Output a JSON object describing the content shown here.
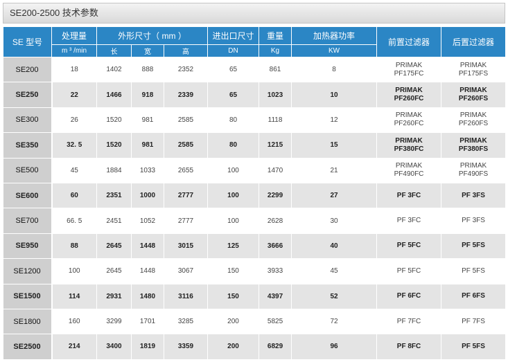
{
  "title": "SE200-2500 技术参数",
  "header": {
    "model": "SE 型号",
    "flow": "处理量",
    "flow_unit": "m ³ /min",
    "dimensions": "外形尺寸（ mm ）",
    "length": "长",
    "width": "宽",
    "height": "高",
    "port": "进出口尺寸",
    "port_unit": "DN",
    "weight": "重量",
    "weight_unit": "Kg",
    "heater": "加热器功率",
    "heater_unit": "KW",
    "pre_filter": "前置过滤器",
    "post_filter": "后置过滤器"
  },
  "rows": [
    {
      "model": "SE200",
      "flow": "18",
      "l": "1402",
      "w": "888",
      "h": "2352",
      "dn": "65",
      "kg": "861",
      "kw": "8",
      "pre1": "PRIMAK",
      "pre2": "PF175FC",
      "post1": "PRIMAK",
      "post2": "PF175FS"
    },
    {
      "model": "SE250",
      "flow": "22",
      "l": "1466",
      "w": "918",
      "h": "2339",
      "dn": "65",
      "kg": "1023",
      "kw": "10",
      "pre1": "PRIMAK",
      "pre2": "PF260FC",
      "post1": "PRIMAK",
      "post2": "PF260FS"
    },
    {
      "model": "SE300",
      "flow": "26",
      "l": "1520",
      "w": "981",
      "h": "2585",
      "dn": "80",
      "kg": "1118",
      "kw": "12",
      "pre1": "PRIMAK",
      "pre2": "PF260FC",
      "post1": "PRIMAK",
      "post2": "PF260FS"
    },
    {
      "model": "SE350",
      "flow": "32. 5",
      "l": "1520",
      "w": "981",
      "h": "2585",
      "dn": "80",
      "kg": "1215",
      "kw": "15",
      "pre1": "PRIMAK",
      "pre2": "PF380FC",
      "post1": "PRIMAK",
      "post2": "PF380FS"
    },
    {
      "model": "SE500",
      "flow": "45",
      "l": "1884",
      "w": "1033",
      "h": "2655",
      "dn": "100",
      "kg": "1470",
      "kw": "21",
      "pre1": "PRIMAK",
      "pre2": "PF490FC",
      "post1": "PRIMAK",
      "post2": "PF490FS"
    },
    {
      "model": "SE600",
      "flow": "60",
      "l": "2351",
      "w": "1000",
      "h": "2777",
      "dn": "100",
      "kg": "2299",
      "kw": "27",
      "pre1": "PF 3FC",
      "pre2": "",
      "post1": "PF 3FS",
      "post2": ""
    },
    {
      "model": "SE700",
      "flow": "66. 5",
      "l": "2451",
      "w": "1052",
      "h": "2777",
      "dn": "100",
      "kg": "2628",
      "kw": "30",
      "pre1": "PF 3FC",
      "pre2": "",
      "post1": "PF 3FS",
      "post2": ""
    },
    {
      "model": "SE950",
      "flow": "88",
      "l": "2645",
      "w": "1448",
      "h": "3015",
      "dn": "125",
      "kg": "3666",
      "kw": "40",
      "pre1": "PF 5FC",
      "pre2": "",
      "post1": "PF 5FS",
      "post2": ""
    },
    {
      "model": "SE1200",
      "flow": "100",
      "l": "2645",
      "w": "1448",
      "h": "3067",
      "dn": "150",
      "kg": "3933",
      "kw": "45",
      "pre1": "PF 5FC",
      "pre2": "",
      "post1": "PF 5FS",
      "post2": ""
    },
    {
      "model": "SE1500",
      "flow": "114",
      "l": "2931",
      "w": "1480",
      "h": "3116",
      "dn": "150",
      "kg": "4397",
      "kw": "52",
      "pre1": "PF 6FC",
      "pre2": "",
      "post1": "PF 6FS",
      "post2": ""
    },
    {
      "model": "SE1800",
      "flow": "160",
      "l": "3299",
      "w": "1701",
      "h": "3285",
      "dn": "200",
      "kg": "5825",
      "kw": "72",
      "pre1": "PF 7FC",
      "pre2": "",
      "post1": "PF 7FS",
      "post2": ""
    },
    {
      "model": "SE2500",
      "flow": "214",
      "l": "3400",
      "w": "1819",
      "h": "3359",
      "dn": "200",
      "kg": "6829",
      "kw": "96",
      "pre1": "PF 8FC",
      "pre2": "",
      "post1": "PF 5FS",
      "post2": ""
    }
  ]
}
